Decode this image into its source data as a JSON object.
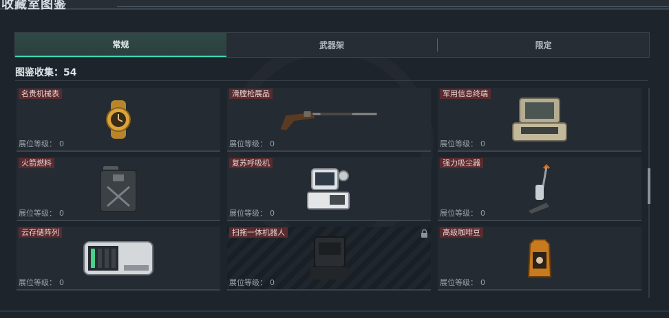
{
  "page": {
    "title": "收藏室图鉴"
  },
  "tabs": [
    {
      "label": "常规",
      "active": true
    },
    {
      "label": "武器架",
      "active": false
    },
    {
      "label": "限定",
      "active": false
    }
  ],
  "collection": {
    "label": "图鉴收集：54"
  },
  "level_label": "展位等级：",
  "items": [
    {
      "name": "名贵机械表",
      "level": "0",
      "icon": "watch-icon"
    },
    {
      "name": "滑膛枪展品",
      "level": "0",
      "icon": "musket-icon"
    },
    {
      "name": "军用信息终端",
      "level": "0",
      "icon": "military-terminal-icon"
    },
    {
      "name": "火箭燃料",
      "level": "0",
      "icon": "fuel-can-icon"
    },
    {
      "name": "复苏呼吸机",
      "level": "0",
      "icon": "ventilator-icon"
    },
    {
      "name": "强力吸尘器",
      "level": "0",
      "icon": "vacuum-icon"
    },
    {
      "name": "云存储阵列",
      "level": "0",
      "icon": "storage-array-icon"
    },
    {
      "name": "扫拖一体机器人",
      "level": "0",
      "icon": "robot-vacuum-icon",
      "locked": true
    },
    {
      "name": "高级咖啡豆",
      "level": "0",
      "icon": "coffee-bag-icon"
    }
  ],
  "colors": {
    "accent": "#3fd8b5",
    "name_tag": "#5a2b2e",
    "card": "#242b33"
  }
}
